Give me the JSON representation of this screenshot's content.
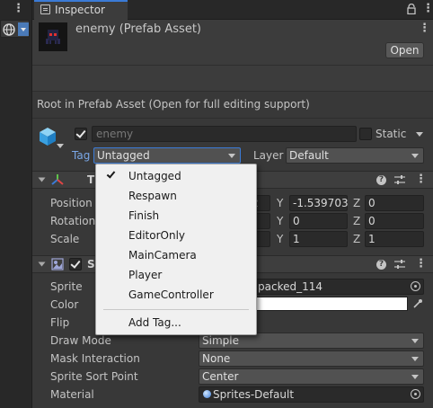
{
  "window": {
    "tab_label": "Inspector",
    "left_kebab": "⋮",
    "tab_kebab": "⋮"
  },
  "header": {
    "title": "enemy (Prefab Asset)",
    "open_button": "Open",
    "kebab": "⋮",
    "root_message": "Root in Prefab Asset (Open for full editing support)"
  },
  "object": {
    "active": true,
    "name": "enemy",
    "static_label": "Static",
    "static_checked": false,
    "tag_label": "Tag",
    "tag_value": "Untagged",
    "layer_label": "Layer",
    "layer_value": "Default"
  },
  "transform": {
    "title": "T",
    "position_label": "Position",
    "rotation_label": "Rotation",
    "scale_label": "Scale",
    "position": {
      "x_partial": "2",
      "y": "-1.539703",
      "z": "0"
    },
    "rotation": {
      "y": "0",
      "z": "0"
    },
    "scale": {
      "y": "1",
      "z": "1"
    },
    "axis_y": "Y",
    "axis_z": "Z"
  },
  "sprite_renderer": {
    "title": "S",
    "enabled": true,
    "props": {
      "sprite_label": "Sprite",
      "sprite_value": "packed_114",
      "color_label": "Color",
      "flip_label": "Flip",
      "draw_mode_label": "Draw Mode",
      "draw_mode_value": "Simple",
      "mask_label": "Mask Interaction",
      "mask_value": "None",
      "sort_point_label": "Sprite Sort Point",
      "sort_point_value": "Center",
      "material_label": "Material",
      "material_value": "Sprites-Default"
    }
  },
  "tag_menu": {
    "items": [
      "Untagged",
      "Respawn",
      "Finish",
      "EditorOnly",
      "MainCamera",
      "Player",
      "GameController"
    ],
    "selected": "Untagged",
    "add_tag": "Add Tag..."
  },
  "colors": {
    "accent": "#3b7bd6",
    "panel": "#383838",
    "menu_bg": "#f0f0f0"
  }
}
